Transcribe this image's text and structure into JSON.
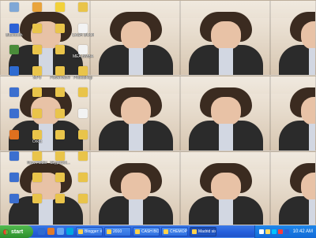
{
  "desktop": {
    "icons": [
      {
        "label": "",
        "icon": "computer-icon"
      },
      {
        "label": "Bluetooth",
        "icon": "bluetooth-icon"
      },
      {
        "label": "",
        "icon": "recycle-bin-icon"
      },
      {
        "label": "",
        "icon": "browser-icon"
      },
      {
        "label": "",
        "icon": "shortcut-icon"
      },
      {
        "label": "",
        "icon": "shortcut-icon"
      },
      {
        "label": "",
        "icon": "firefox-icon"
      },
      {
        "label": "",
        "icon": "shortcut-icon"
      },
      {
        "label": "",
        "icon": "shortcut-icon"
      },
      {
        "label": "",
        "icon": "shortcut-icon"
      },
      {
        "label": "",
        "icon": "chat-icon"
      },
      {
        "label": "",
        "icon": "folder-icon"
      },
      {
        "label": "",
        "icon": "folder-icon"
      },
      {
        "label": "MP3",
        "icon": "folder-icon"
      },
      {
        "label": "",
        "icon": "folder-icon"
      },
      {
        "label": "",
        "icon": "folder-icon"
      },
      {
        "label": "Orkut",
        "icon": "folder-icon"
      },
      {
        "label": "New Folder",
        "icon": "folder-icon"
      },
      {
        "label": "",
        "icon": "folder-icon"
      },
      {
        "label": "",
        "icon": "folder-icon"
      },
      {
        "label": "",
        "icon": "smiley-icon"
      },
      {
        "label": "",
        "icon": "folder-icon"
      },
      {
        "label": "",
        "icon": "folder-icon"
      },
      {
        "label": "Powerwave",
        "icon": "folder-icon"
      },
      {
        "label": "",
        "icon": "folder-icon"
      },
      {
        "label": "",
        "icon": "folder-icon"
      },
      {
        "label": "",
        "icon": "folder-icon"
      },
      {
        "label": "SkypeSet...",
        "icon": "folder-icon"
      },
      {
        "label": "",
        "icon": "folder-icon"
      },
      {
        "label": "",
        "icon": "folder-icon"
      },
      {
        "label": "",
        "icon": "folder-icon"
      },
      {
        "label": "CASH BOOK",
        "icon": "document-icon"
      },
      {
        "label": "MEA BMBA",
        "icon": "document-icon"
      },
      {
        "label": "Photoshop",
        "icon": "folder-icon"
      },
      {
        "label": "",
        "icon": "folder-icon"
      },
      {
        "label": "",
        "icon": "document-icon"
      },
      {
        "label": "",
        "icon": "folder-icon"
      },
      {
        "label": "",
        "icon": "folder-icon"
      },
      {
        "label": "",
        "icon": "folder-icon"
      },
      {
        "label": "",
        "icon": "folder-icon"
      }
    ],
    "icon_colors": {
      "computer-icon": "#7fa7d6",
      "bluetooth-icon": "#2b61d6",
      "recycle-bin-icon": "#4a8c3a",
      "browser-icon": "#2e6bd1",
      "firefox-icon": "#e0701f",
      "shortcut-icon": "#3c6fcf",
      "chat-icon": "#e9a43c",
      "folder-icon": "#e9c44a",
      "smiley-icon": "#f2d13a",
      "document-icon": "#f2f2f2"
    }
  },
  "taskbar": {
    "start_label": "start",
    "quick_launch": [
      {
        "icon": "ie-icon",
        "color": "#2e6bd1"
      },
      {
        "icon": "media-icon",
        "color": "#e07a2a"
      },
      {
        "icon": "desktop-icon",
        "color": "#6aa7ef"
      },
      {
        "icon": "skype-icon",
        "color": "#00a7e1"
      }
    ],
    "tasks": [
      {
        "label": "Blogger: ##...",
        "icon": "blogger-icon"
      },
      {
        "label": "2010",
        "icon": "folder-icon"
      },
      {
        "label": "CASH BOOK ...",
        "icon": "excel-icon"
      },
      {
        "label": "CHEMOPHA...",
        "icon": "word-icon"
      },
      {
        "label": "Madrid sispen...",
        "icon": "paint-icon"
      }
    ],
    "tray": {
      "icons": [
        {
          "icon": "network-icon",
          "color": "#ffffff"
        },
        {
          "icon": "volume-icon",
          "color": "#ffdc63"
        },
        {
          "icon": "skype-icon",
          "color": "#00c3ff"
        },
        {
          "icon": "security-icon",
          "color": "#ff3b3b"
        },
        {
          "icon": "bluetooth-icon",
          "color": "#2b61d6"
        }
      ],
      "clock": "10:42 AM"
    }
  }
}
